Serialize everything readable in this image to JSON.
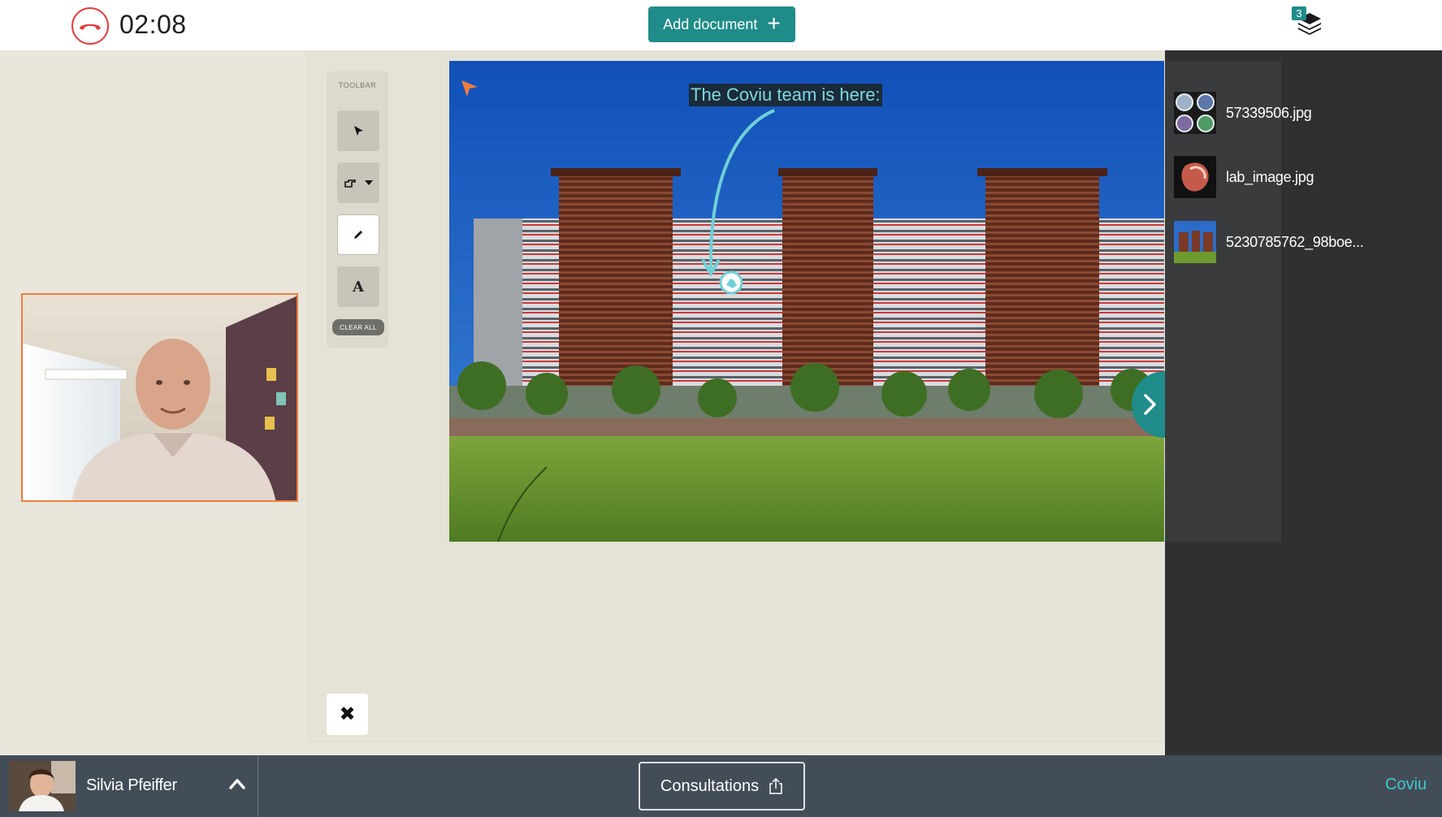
{
  "header": {
    "call_timer": "02:08",
    "add_document_label": "Add document",
    "documents_count": "3"
  },
  "toolbar": {
    "title": "TOOLBAR",
    "text_tool_glyph": "A",
    "clear_all_label": "CLEAR ALL",
    "active_tool": "pen"
  },
  "document": {
    "caption": "The Coviu team is here:"
  },
  "files": [
    {
      "name": "57339506.jpg"
    },
    {
      "name": "lab_image.jpg"
    },
    {
      "name": "5230785762_98boe..."
    }
  ],
  "footer": {
    "user_name": "Silvia Pfeiffer",
    "consultations_label": "Consultations",
    "brand": "Coviu"
  },
  "colors": {
    "accent": "#1f8c8a",
    "hangup": "#e03d3d",
    "video_border": "#ef7d3c",
    "bottom_bar": "#434d57",
    "side_panel": "#2f3031",
    "caption_text": "#7fd7dd",
    "brand_text": "#41c7cc"
  },
  "icons": {
    "hangup": "phone-hangup-icon",
    "add": "plus-icon",
    "layers": "layers-icon",
    "select": "cursor-arrow-icon",
    "pointer": "hand-pointer-icon",
    "pen": "pencil-icon",
    "text": "text-icon",
    "close": "close-x-icon",
    "next": "chevron-right-icon",
    "collapse": "chevron-up-icon",
    "share": "share-upload-icon"
  }
}
